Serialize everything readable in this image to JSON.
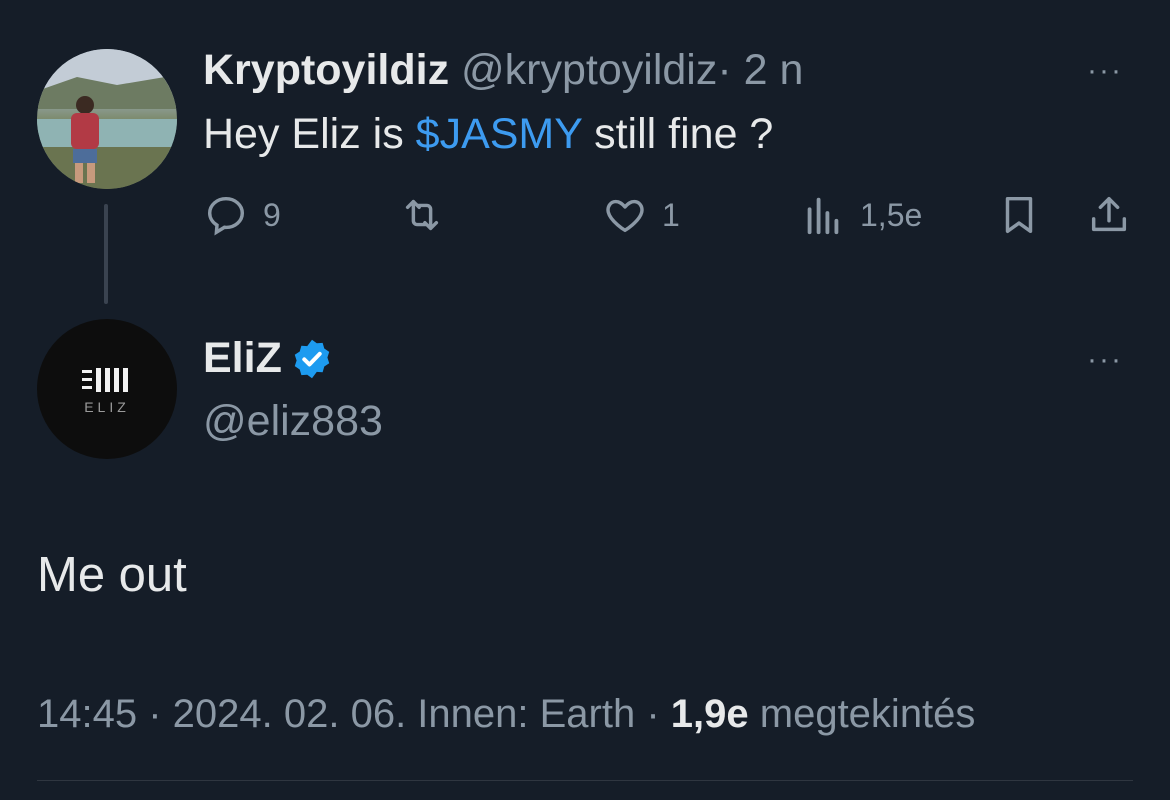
{
  "tweet1": {
    "display_name": "Kryptoyildiz",
    "handle": "@kryptoyildiz",
    "separator": "·",
    "time": "2 n",
    "text_before": "Hey Eliz is ",
    "cashtag": "$JASMY",
    "text_after": " still fine ?",
    "more": "···",
    "replies": "9",
    "likes": "1",
    "views": "1,5e",
    "icons": [
      "reply-icon",
      "retweet-icon",
      "like-icon",
      "views-icon",
      "bookmark-icon",
      "share-icon"
    ]
  },
  "tweet2": {
    "display_name": "EliZ",
    "handle": "@eliz883",
    "avatar_text": "ELIZ",
    "more": "···",
    "text": "Me out",
    "meta_time": "14:45",
    "meta_sep1": " · ",
    "meta_date": "2024. 02. 06. Innen: Earth",
    "meta_sep2": " · ",
    "views_count": "1,9e",
    "views_label": " megtekintés"
  },
  "colors": {
    "background": "#151d28",
    "text": "#e7e9ea",
    "muted": "#8b98a5",
    "link": "#3d9bf0",
    "verified": "#1d9bf0"
  }
}
